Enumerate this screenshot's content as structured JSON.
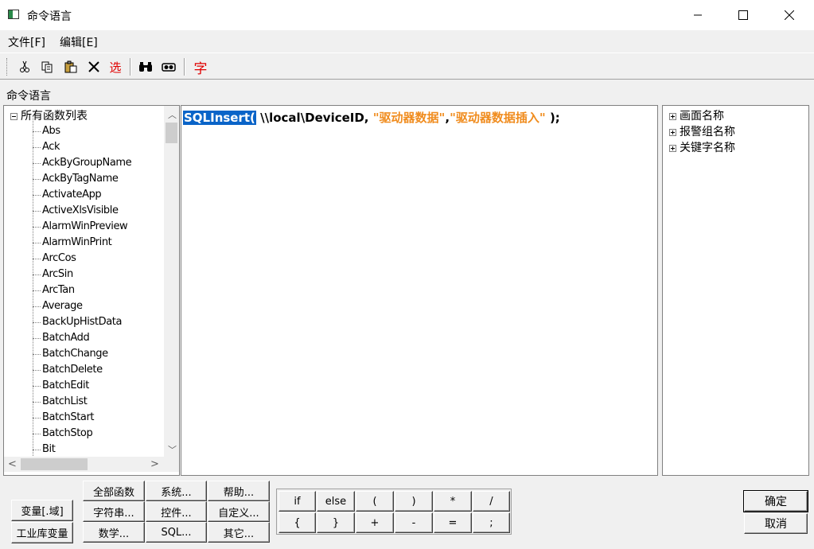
{
  "window": {
    "title": "命令语言"
  },
  "menu": {
    "file": "文件[F]",
    "edit": "编辑[E]"
  },
  "toolbar": {
    "select": "选",
    "font": "字"
  },
  "section_label": "命令语言",
  "left_tree": {
    "root": "所有函数列表",
    "items": [
      "Abs",
      "Ack",
      "AckByGroupName",
      "AckByTagName",
      "ActivateApp",
      "ActiveXlsVisible",
      "AlarmWinPreview",
      "AlarmWinPrint",
      "ArcCos",
      "ArcSin",
      "ArcTan",
      "Average",
      "BackUpHistData",
      "BatchAdd",
      "BatchChange",
      "BatchDelete",
      "BatchEdit",
      "BatchList",
      "BatchStart",
      "BatchStop",
      "Bit"
    ]
  },
  "editor": {
    "selected": "SQLInsert(",
    "arg1": " \\\\local\\DeviceID, ",
    "str1": "\"驱动器数据\"",
    "comma": ",",
    "str2": "\"驱动器数据插入\"",
    "tail": "  );"
  },
  "right_tree": {
    "items": [
      "画面名称",
      "报警组名称",
      "关键字名称"
    ]
  },
  "buttons": {
    "var_field": "变量[.域]",
    "industrial_var": "工业库变量",
    "all_funcs": "全部函数",
    "system": "系统...",
    "help": "帮助...",
    "string": "字符串...",
    "control": "控件...",
    "custom": "自定义...",
    "math": "数学...",
    "sql": "SQL...",
    "other": "其它...",
    "if": "if",
    "else": "else",
    "lparen": "(",
    "rparen": ")",
    "mul": "*",
    "div": "/",
    "lbrace": "{",
    "rbrace": "}",
    "plus": "+",
    "minus": "-",
    "eq": "=",
    "semi": ";",
    "ok": "确定",
    "cancel": "取消"
  }
}
